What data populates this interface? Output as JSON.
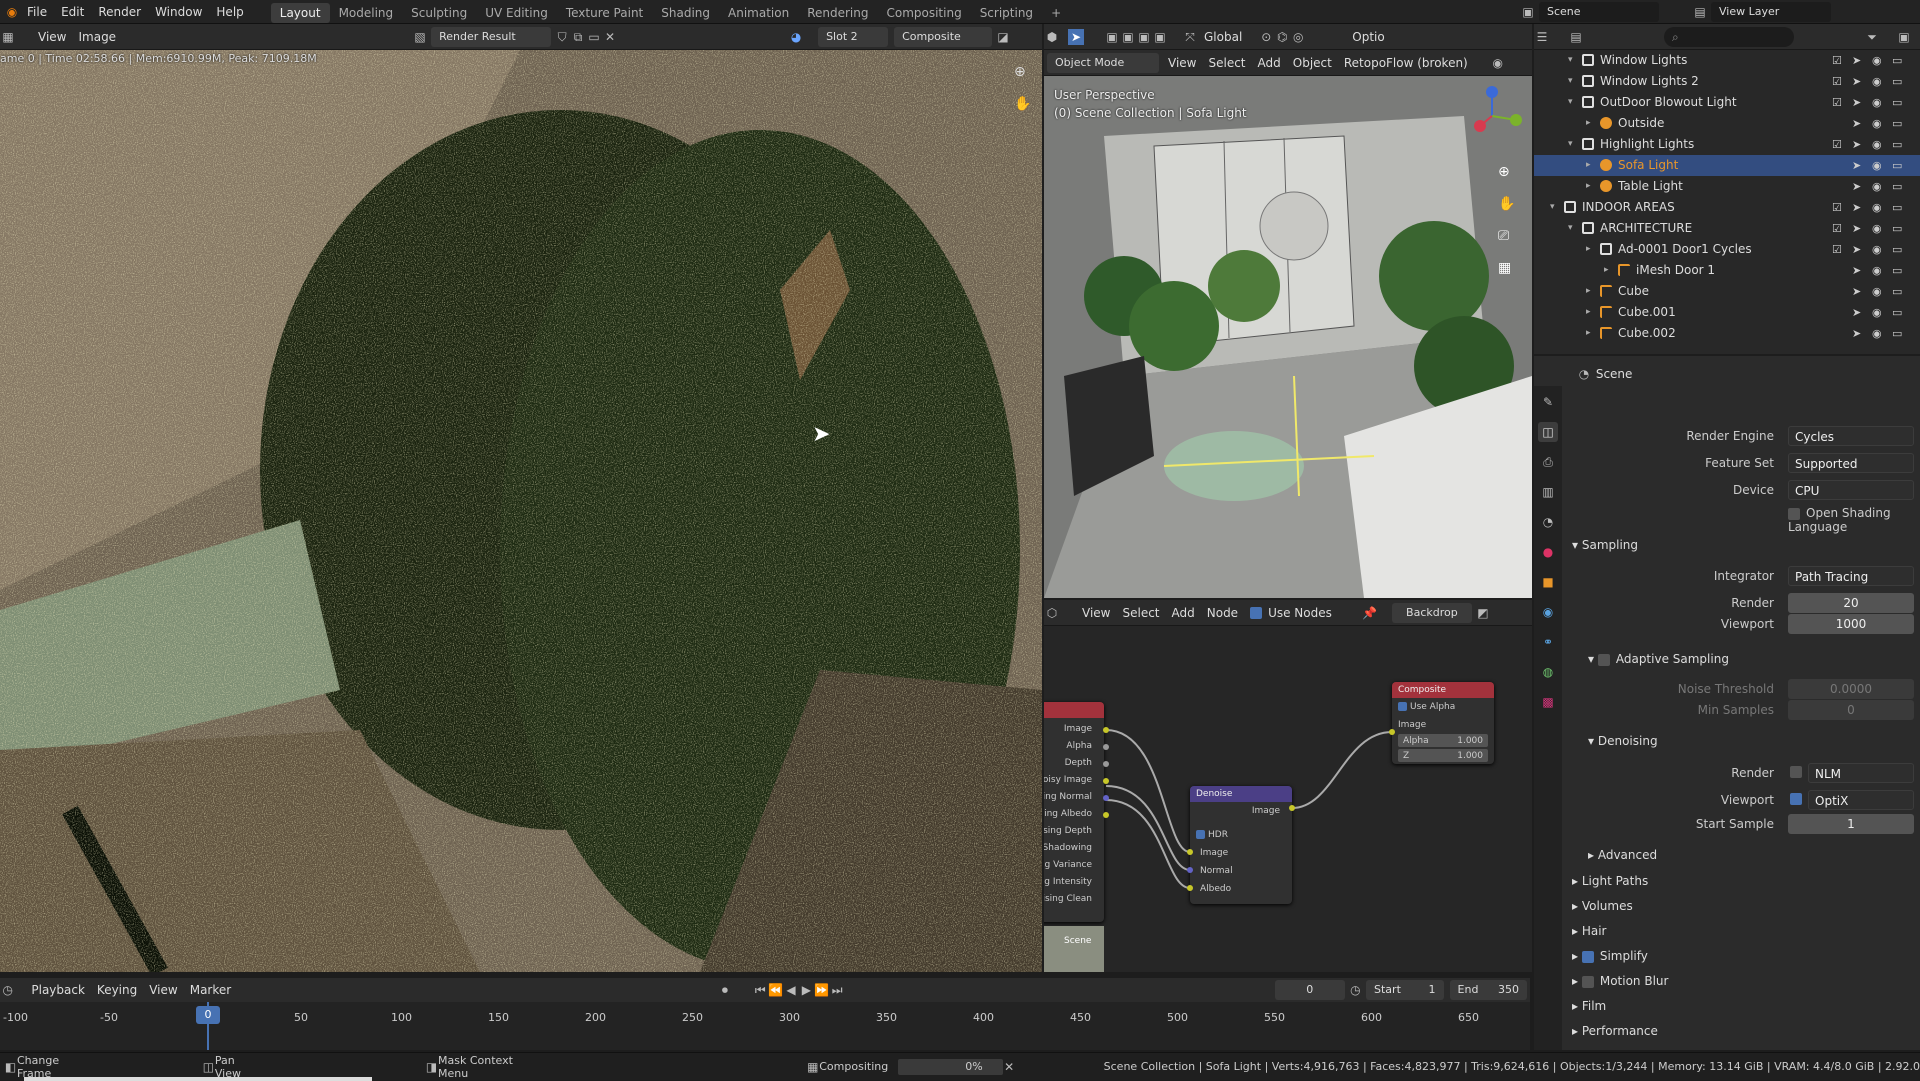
{
  "topbar": {
    "menus": [
      "File",
      "Edit",
      "Render",
      "Window",
      "Help"
    ],
    "workspaces": [
      "Layout",
      "Modeling",
      "Sculpting",
      "UV Editing",
      "Texture Paint",
      "Shading",
      "Animation",
      "Rendering",
      "Compositing",
      "Scripting"
    ],
    "active_workspace": "Layout",
    "add_tab": "+",
    "scene_name": "Scene",
    "view_layer": "View Layer"
  },
  "image_editor": {
    "menu_view": "View",
    "menu_image": "Image",
    "image_name": "Render Result",
    "slot": "Slot 2",
    "pass": "Composite",
    "render_info": "ame 0 | Time 02:58.66 | Mem:6910.99M, Peak: 7109.18M"
  },
  "viewport": {
    "mode": "Object Mode",
    "menus": [
      "View",
      "Select",
      "Add",
      "Object"
    ],
    "addon_menu": "RetopoFlow (broken)",
    "orientation": "Global",
    "options_label": "Optio",
    "perspective": "User Perspective",
    "collection_info": "(0) Scene Collection | Sofa Light"
  },
  "node_editor": {
    "menus": [
      "View",
      "Select",
      "Add",
      "Node"
    ],
    "use_nodes_label": "Use Nodes",
    "use_nodes": true,
    "backdrop_label": "Backdrop",
    "render_layers_outputs": [
      "Image",
      "Alpha",
      "Depth",
      "Noisy Image",
      "oising Normal",
      "oising Albedo",
      "oising Depth",
      "ing Shadowing",
      "sing Variance",
      "ing Intensity",
      "oising Clean"
    ],
    "render_layers_scene": "Scene",
    "denoise": {
      "title": "Denoise",
      "output": "Image",
      "hdr_label": "HDR",
      "inputs": [
        "Image",
        "Normal",
        "Albedo"
      ]
    },
    "composite": {
      "title": "Composite",
      "use_alpha_label": "Use Alpha",
      "image_label": "Image",
      "alpha_label": "Alpha",
      "alpha_value": "1.000",
      "z_label": "Z",
      "z_value": "1.000"
    }
  },
  "outliner": {
    "rows": [
      {
        "label": "Window Lights",
        "indent": 2,
        "kind": "collection"
      },
      {
        "label": "Window Lights 2",
        "indent": 2,
        "kind": "collection"
      },
      {
        "label": "OutDoor Blowout Light",
        "indent": 2,
        "kind": "collection"
      },
      {
        "label": "Outside",
        "indent": 3,
        "kind": "light"
      },
      {
        "label": "Highlight Lights",
        "indent": 2,
        "kind": "collection"
      },
      {
        "label": "Sofa Light",
        "indent": 3,
        "kind": "light",
        "selected": true
      },
      {
        "label": "Table Light",
        "indent": 3,
        "kind": "light"
      },
      {
        "label": "INDOOR AREAS",
        "indent": 1,
        "kind": "collection"
      },
      {
        "label": "ARCHITECTURE",
        "indent": 2,
        "kind": "collection"
      },
      {
        "label": "Ad-0001 Door1 Cycles",
        "indent": 3,
        "kind": "collection"
      },
      {
        "label": "iMesh Door 1",
        "indent": 4,
        "kind": "mesh"
      },
      {
        "label": "Cube",
        "indent": 3,
        "kind": "mesh"
      },
      {
        "label": "Cube.001",
        "indent": 3,
        "kind": "mesh"
      },
      {
        "label": "Cube.002",
        "indent": 3,
        "kind": "mesh"
      }
    ]
  },
  "properties": {
    "context": "Scene",
    "render_engine_label": "Render Engine",
    "render_engine": "Cycles",
    "feature_set_label": "Feature Set",
    "feature_set": "Supported",
    "device_label": "Device",
    "device": "CPU",
    "osl_label": "Open Shading Language",
    "sampling_label": "Sampling",
    "integrator_label": "Integrator",
    "integrator": "Path Tracing",
    "render_label": "Render",
    "render_samples": "20",
    "viewport_label": "Viewport",
    "viewport_samples": "1000",
    "adaptive_label": "Adaptive Sampling",
    "noise_threshold_label": "Noise Threshold",
    "noise_threshold": "0.0000",
    "min_samples_label": "Min Samples",
    "min_samples": "0",
    "denoising_label": "Denoising",
    "den_render_label": "Render",
    "den_render": "NLM",
    "den_viewport_label": "Viewport",
    "den_viewport": "OptiX",
    "start_sample_label": "Start Sample",
    "start_sample": "1",
    "advanced_label": "Advanced",
    "panels": [
      "Light Paths",
      "Volumes",
      "Hair",
      "Simplify",
      "Motion Blur",
      "Film",
      "Performance"
    ]
  },
  "timeline": {
    "menus": [
      "Playback",
      "Keying",
      "View",
      "Marker"
    ],
    "current_frame": "0",
    "start_label": "Start",
    "start": "1",
    "end_label": "End",
    "end": "350",
    "ticks": [
      "-100",
      "-50",
      "0",
      "50",
      "100",
      "150",
      "200",
      "250",
      "300",
      "350",
      "400",
      "450",
      "500",
      "550",
      "600",
      "650"
    ],
    "playhead": "0"
  },
  "status": {
    "change_frame": "Change Frame",
    "pan_view": "Pan View",
    "context_menu": "Mask Context Menu",
    "compositing": "Compositing",
    "progress": "0%",
    "stats": "Scene Collection | Sofa Light | Verts:4,916,763 | Faces:4,823,977 | Tris:9,624,616 | Objects:1/3,244 | Memory: 13.14 GiB | VRAM: 4.4/8.0 GiB | 2.92.0"
  }
}
